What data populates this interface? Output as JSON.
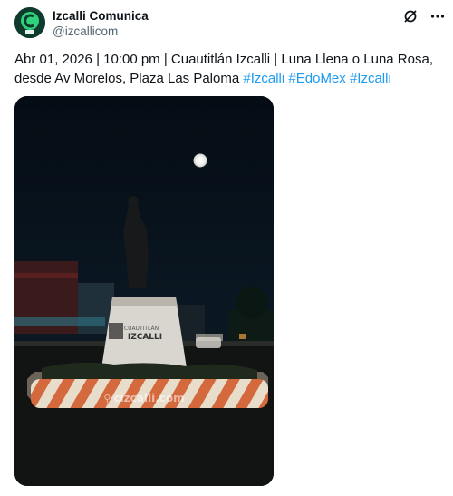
{
  "author": {
    "display_name": "Izcalli Comunica",
    "handle": "@izcallicom"
  },
  "icons": {
    "avatar": "izcalli-logo",
    "actions": [
      "grok-icon",
      "more-icon"
    ]
  },
  "tweet": {
    "text": "Abr 01, 2026 | 10:00 pm | Cuautitlán Izcalli | Luna Llena o Luna Rosa, desde Av Morelos, Plaza Las Paloma ",
    "hashtags": [
      "#Izcalli",
      "#EdoMex",
      "#Izcalli"
    ]
  },
  "media": {
    "watermark": "cizcalli.com",
    "monument_sign": [
      "CUAUTITLÁN",
      "IZCALLI"
    ]
  },
  "colors": {
    "hashtag": "#1d9bf0",
    "text": "#0f1419",
    "secondary": "#536471"
  }
}
